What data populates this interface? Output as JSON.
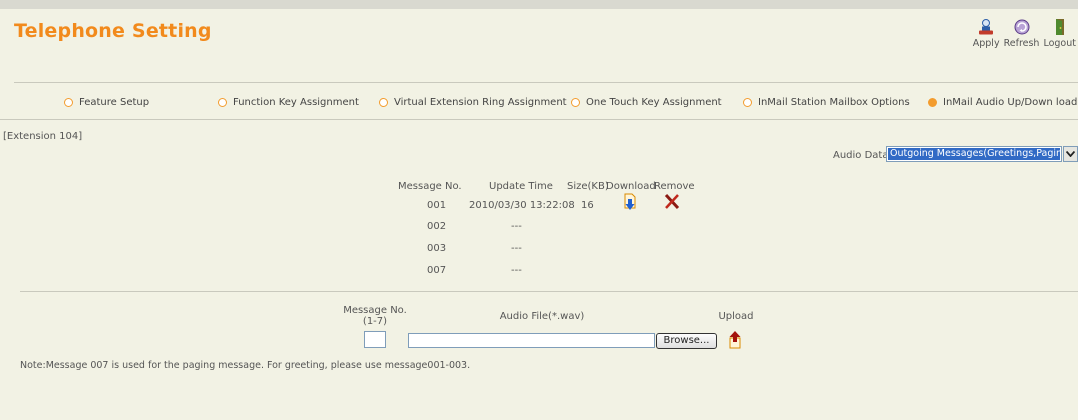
{
  "header": {
    "title": "Telephone Setting",
    "toolbar": [
      {
        "label": "Apply",
        "icon": "apply-icon"
      },
      {
        "label": "Refresh",
        "icon": "refresh-icon"
      },
      {
        "label": "Logout",
        "icon": "logout-icon"
      }
    ]
  },
  "tabs": [
    {
      "label": "Feature Setup",
      "selected": false
    },
    {
      "label": "Function Key Assignment",
      "selected": false
    },
    {
      "label": "Virtual Extension Ring Assignment",
      "selected": false
    },
    {
      "label": "One Touch Key Assignment",
      "selected": false
    },
    {
      "label": "InMail Station Mailbox Options",
      "selected": false
    },
    {
      "label": "InMail Audio Up/Down load",
      "selected": true
    }
  ],
  "extension_label": "[Extension 104]",
  "audio_data": {
    "label": "Audio Data",
    "selected": "Outgoing Messages(Greetings,Paging)"
  },
  "table": {
    "headers": {
      "message_no": "Message No.",
      "update_time": "Update Time",
      "size": "Size(KB)",
      "download": "Download",
      "remove": "Remove"
    },
    "rows": [
      {
        "message_no": "001",
        "update_time": "2010/03/30 13:22:08",
        "size": "16",
        "has_file": true
      },
      {
        "message_no": "002",
        "update_time": "---",
        "size": "",
        "has_file": false
      },
      {
        "message_no": "003",
        "update_time": "---",
        "size": "",
        "has_file": false
      },
      {
        "message_no": "007",
        "update_time": "---",
        "size": "",
        "has_file": false
      }
    ]
  },
  "upload_form": {
    "message_no_label": "Message No.",
    "message_no_range": "(1-7)",
    "message_no_value": "",
    "audio_file_label": "Audio File(*.wav)",
    "audio_file_value": "",
    "browse_label": "Browse...",
    "upload_label": "Upload"
  },
  "note": "Note:Message 007 is used for the paging message. For greeting, please use message001-003.",
  "colors": {
    "accent": "#f28a1c",
    "background": "#f2f2e4",
    "select_highlight": "#316ac5"
  }
}
